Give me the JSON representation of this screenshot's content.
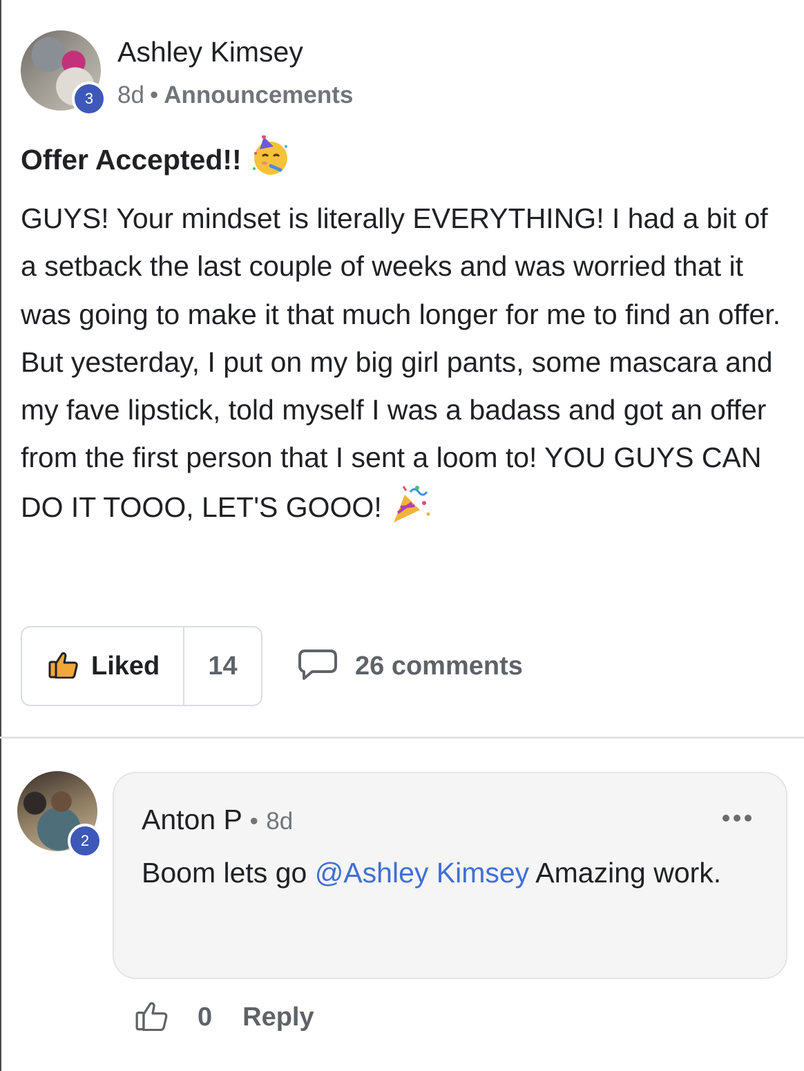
{
  "post": {
    "author": "Ashley Kimsey",
    "author_level": "3",
    "time": "8d",
    "separator": "•",
    "category": "Announcements",
    "title": "Offer Accepted!!",
    "title_emoji": "partying-face-emoji",
    "body": "GUYS! Your mindset is literally EVERYTHING! I had a bit of a setback the last couple of weeks and was worried that it was going to make it that much longer for me to find an offer. But yesterday, I put on my big girl pants, some mascara and my fave lipstick, told myself I was a badass and got an offer from the first person that I sent a loom to! YOU GUYS CAN DO IT TOOO, LET'S GOOO!",
    "body_emoji": "party-popper-emoji"
  },
  "actions": {
    "like_label": "Liked",
    "like_count": "14",
    "comments_label": "26 comments"
  },
  "comment": {
    "author": "Anton P",
    "author_level": "2",
    "separator": "•",
    "time": "8d",
    "text_before": "Boom lets go ",
    "mention": "@Ashley Kimsey",
    "text_after": " Amazing work.",
    "like_count": "0",
    "reply_label": "Reply"
  },
  "colors": {
    "accent_blue": "#3d58b8",
    "mention_blue": "#3f6fd8",
    "muted_text": "#5f6368",
    "bubble_bg": "#f5f5f5"
  }
}
